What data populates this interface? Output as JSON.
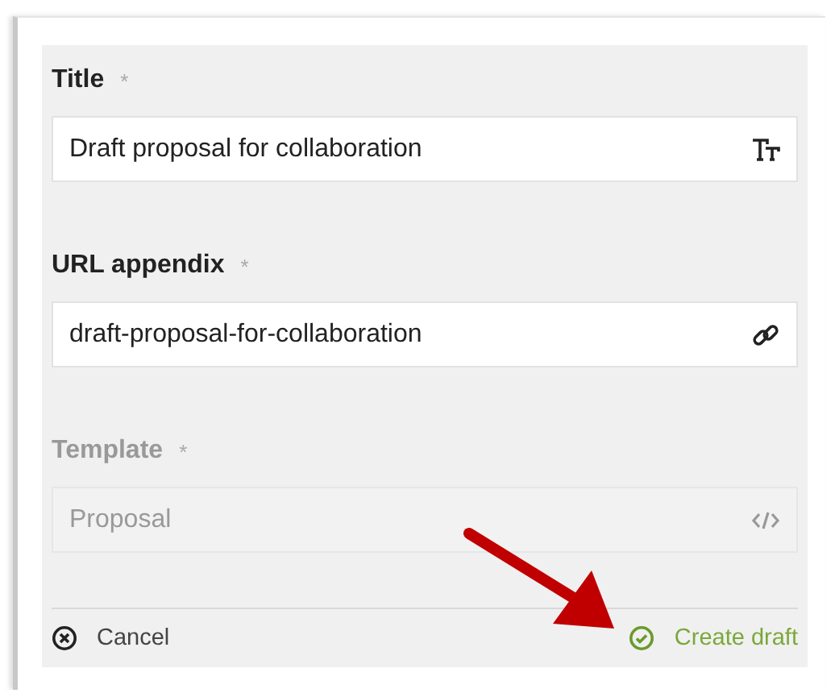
{
  "fields": [
    {
      "label": "Title",
      "asterisk": "*",
      "value": "Draft proposal for collaboration",
      "disabled": false,
      "kind": "text-size"
    },
    {
      "label": "URL appendix",
      "asterisk": "*",
      "value": "draft-proposal-for-collaboration",
      "disabled": false,
      "kind": "link"
    },
    {
      "label": "Template",
      "asterisk": "*",
      "value": "Proposal",
      "disabled": true,
      "kind": "code"
    }
  ],
  "footer": [
    {
      "label": "Cancel",
      "kind": "cancel"
    },
    {
      "label": "Create draft",
      "kind": "confirm"
    }
  ]
}
